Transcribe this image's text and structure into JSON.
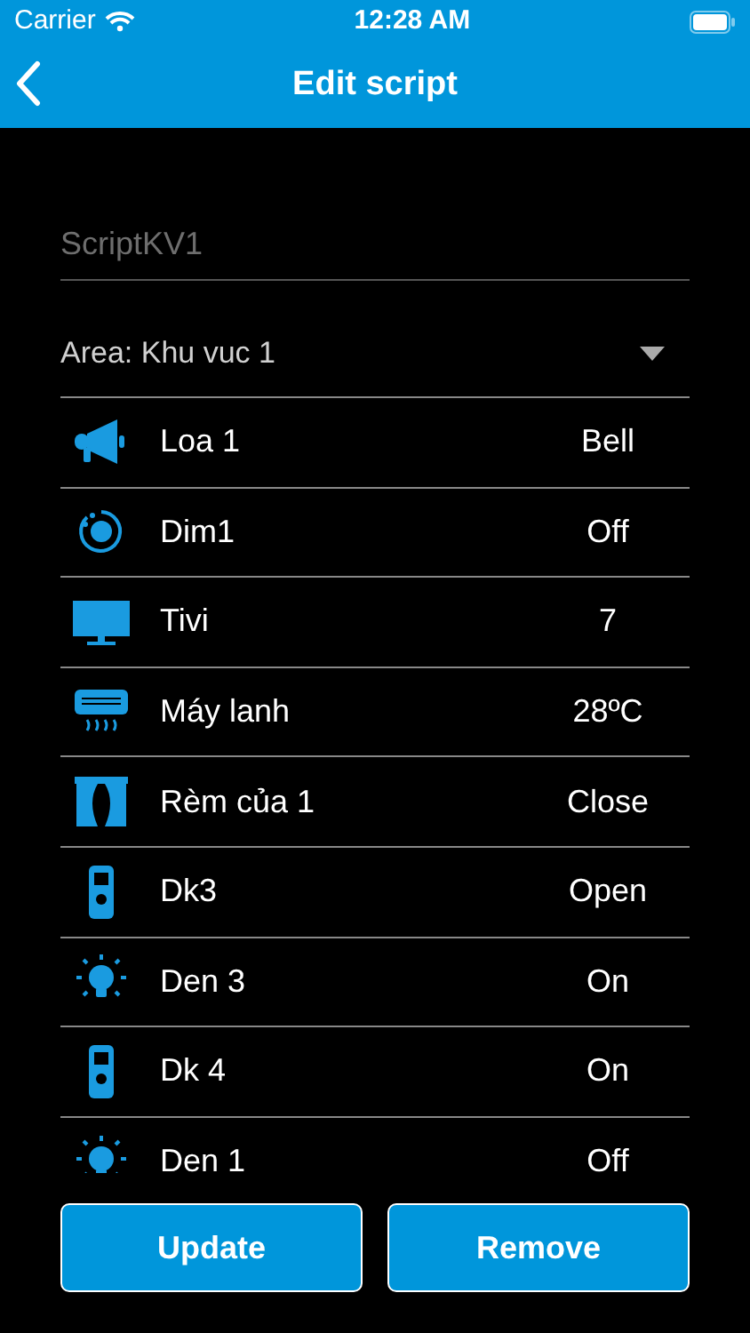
{
  "status_bar": {
    "carrier": "Carrier",
    "time": "12:28 AM"
  },
  "nav": {
    "title": "Edit script"
  },
  "name_field": {
    "placeholder": "ScriptKV1"
  },
  "area": {
    "label": "Area: Khu vuc 1"
  },
  "devices": [
    {
      "kind": "speaker",
      "name": "Loa 1",
      "value": "Bell"
    },
    {
      "kind": "dimmer",
      "name": "Dim1",
      "value": "Off"
    },
    {
      "kind": "tv",
      "name": "Tivi",
      "value": "7"
    },
    {
      "kind": "aircon",
      "name": "Máy lanh",
      "value": "28ºC"
    },
    {
      "kind": "curtain",
      "name": "Rèm của 1",
      "value": "Close"
    },
    {
      "kind": "remote",
      "name": "Dk3",
      "value": "Open"
    },
    {
      "kind": "bulb",
      "name": "Den 3",
      "value": "On"
    },
    {
      "kind": "remote",
      "name": "Dk 4",
      "value": "On"
    },
    {
      "kind": "bulb",
      "name": "Den 1",
      "value": "Off"
    }
  ],
  "buttons": [
    "Update",
    "Remove"
  ]
}
